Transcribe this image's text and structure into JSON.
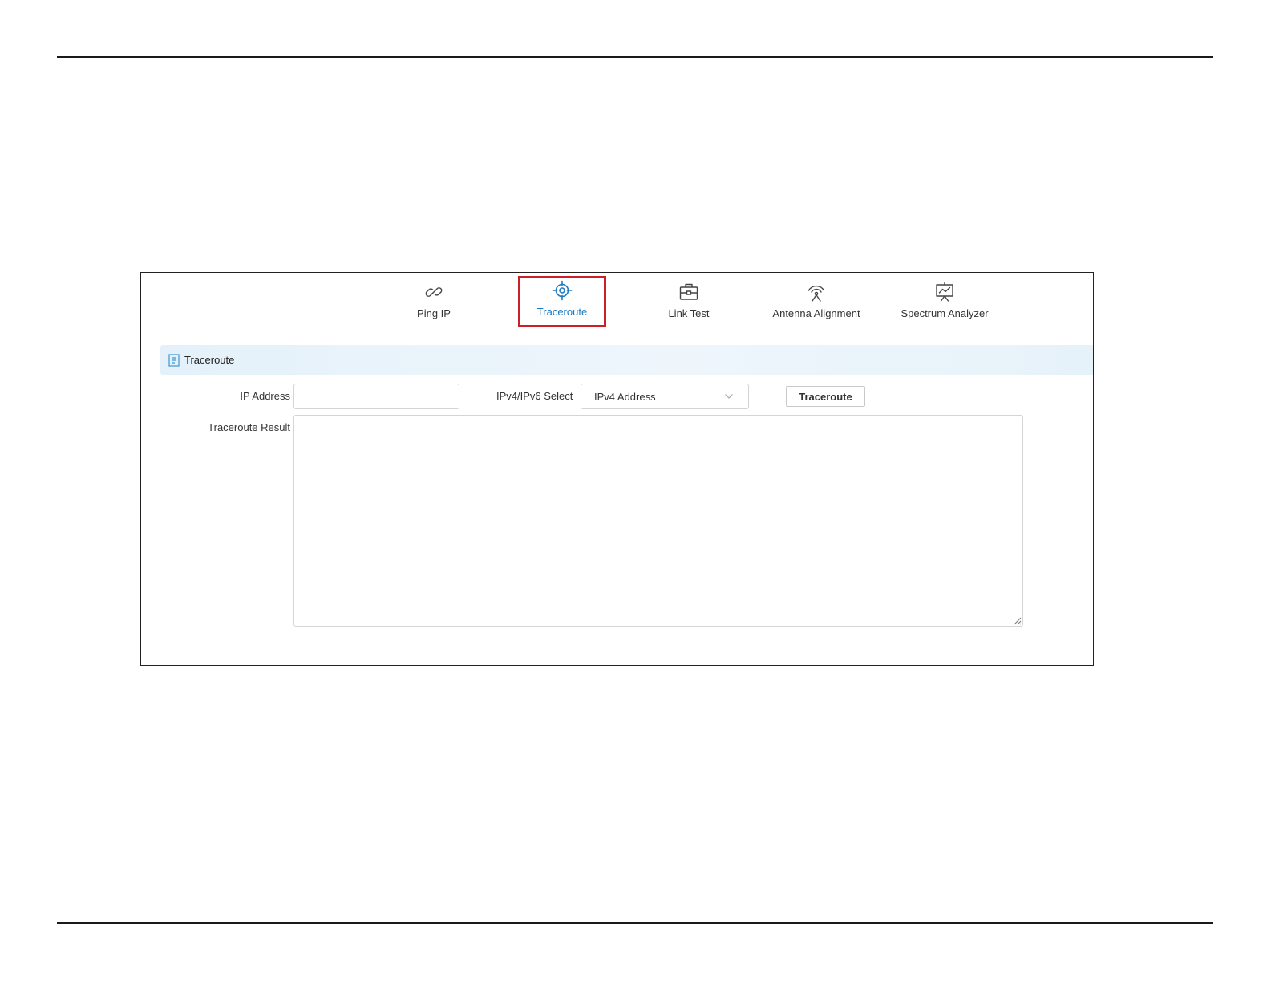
{
  "tabs": [
    {
      "label": "Ping IP",
      "icon": "link-icon",
      "active": false
    },
    {
      "label": "Traceroute",
      "icon": "crosshair-icon",
      "active": true
    },
    {
      "label": "Link Test",
      "icon": "toolbox-icon",
      "active": false
    },
    {
      "label": "Antenna Alignment",
      "icon": "antenna-icon",
      "active": false
    },
    {
      "label": "Spectrum Analyzer",
      "icon": "presentation-chart-icon",
      "active": false
    }
  ],
  "section": {
    "title": "Traceroute",
    "icon": "document-icon"
  },
  "form": {
    "ip_address": {
      "label": "IP Address",
      "value": "",
      "placeholder": ""
    },
    "ip_version": {
      "label": "IPv4/IPv6 Select",
      "selected": "IPv4 Address",
      "icon": "chevron-down-icon"
    },
    "traceroute_button": "Traceroute",
    "result": {
      "label": "Traceroute Result",
      "value": ""
    }
  },
  "colors": {
    "active_tab_text": "#1f7bc1",
    "highlight_box": "#cc1f2a",
    "section_header_bg": "#e6f2fa",
    "page_rule": "#1a1a1a"
  }
}
